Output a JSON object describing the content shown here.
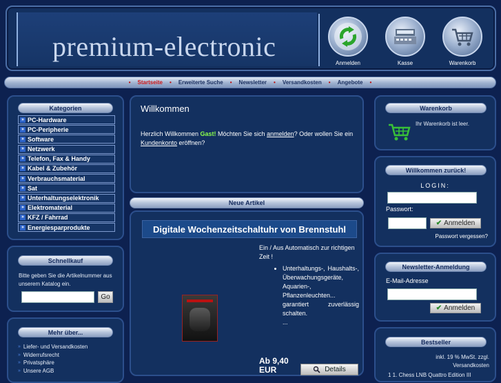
{
  "header": {
    "logo": "premium-electronic",
    "buttons": [
      {
        "label": "Anmelden",
        "icon": "login-arrows-icon"
      },
      {
        "label": "Kasse",
        "icon": "cash-register-icon"
      },
      {
        "label": "Warenkorb",
        "icon": "shopping-cart-icon"
      }
    ]
  },
  "nav": {
    "items": [
      "Startseite",
      "Erweiterte Suche",
      "Newsletter",
      "Versandkosten",
      "Angebote"
    ],
    "active": "Startseite"
  },
  "categories": {
    "title": "Kategorien",
    "items": [
      "PC-Hardware",
      "PC-Peripherie",
      "Software",
      "Netzwerk",
      "Telefon, Fax & Handy",
      "Kabel & Zubehör",
      "Verbrauchsmaterial",
      "Sat",
      "Unterhaltungselektronik",
      "Elektromaterial",
      "KFZ / Fahrrad",
      "Energiesparprodukte"
    ]
  },
  "quickbuy": {
    "title": "Schnellkauf",
    "text": "Bitte geben Sie die Artikelnummer aus unserem Katalog ein.",
    "button": "Go"
  },
  "more": {
    "title": "Mehr über...",
    "items": [
      "Liefer- und Versandkosten",
      "Widerrufsrecht",
      "Privatsphäre",
      "Unsere AGB"
    ]
  },
  "welcome": {
    "title": "Willkommen",
    "text_before": "Herzlich Willkommen ",
    "guest": "Gast!",
    "text_mid": " Möchten Sie sich ",
    "link_login": "anmelden",
    "text_mid2": "? Oder wollen Sie ein ",
    "link_account": "Kundenkonto",
    "text_after": " eröffnen?"
  },
  "new_articles": {
    "title": "Neue Artikel",
    "product": {
      "name": "Digitale Wochenzeitschaltuhr von Brennstuhl",
      "desc_intro": "Ein / Aus Automatisch zur richtigen Zeit !",
      "desc_bullet": "Unterhaltungs-, Haushalts-, Überwachungsgeräte, Aquarien-, Pflanzenleuchten... garantiert zuverlässig schalten.",
      "ellipsis": "...",
      "price_line1": "Ab 9,40",
      "price_line2": "EUR",
      "details": "Details"
    }
  },
  "cart": {
    "title": "Warenkorb",
    "text": "Ihr Warenkorb ist leer."
  },
  "login": {
    "title": "Willkommen zurück!",
    "label_login": "LOGIN:",
    "label_password": "Passwort:",
    "button": "Anmelden",
    "forgot": "Passwort vergessen?"
  },
  "newsletter": {
    "title": "Newsletter-Anmeldung",
    "label": "E-Mail-Adresse",
    "button": "Anmelden"
  },
  "bestseller": {
    "title": "Bestseller",
    "vat": "inkl. 19 % MwSt. zzgl.",
    "shipping": "Versandkosten",
    "item": "1 1. Chess LNB Quattro Edition III"
  },
  "colors": {
    "background": "#0d2150",
    "panel": "#13305f",
    "accent_green": "#8cff4b",
    "active_red": "#d01818"
  }
}
